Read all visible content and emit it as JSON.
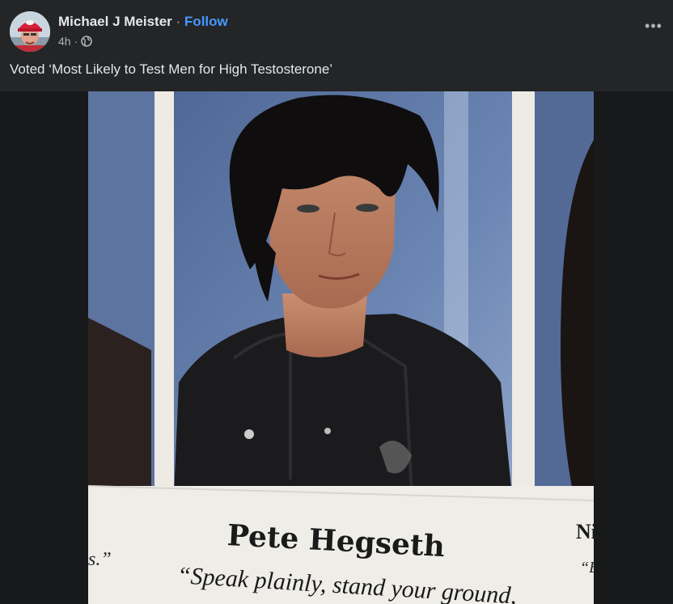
{
  "post": {
    "author": "Michael J Meister",
    "separator": "·",
    "follow_label": "Follow",
    "timestamp": "4h",
    "timestamp_separator": "·",
    "audience_icon": "globe-icon",
    "more_icon": "more-options-icon",
    "more_label": "•••",
    "caption": "Voted ‘Most Likely to Test Men for High Testosterone’"
  },
  "photo": {
    "subject_name": "Pete Hegseth",
    "quote": "“Speak plainly, stand your ground,",
    "left_fragment": "s.”",
    "right_name_fragment": "Ni",
    "right_quote_fragment": "“B"
  },
  "colors": {
    "header_bg": "#242526",
    "page_bg": "#18191a",
    "follow": "#4599ff",
    "text": "#e4e6eb",
    "secondary_text": "#b0b3b8"
  }
}
